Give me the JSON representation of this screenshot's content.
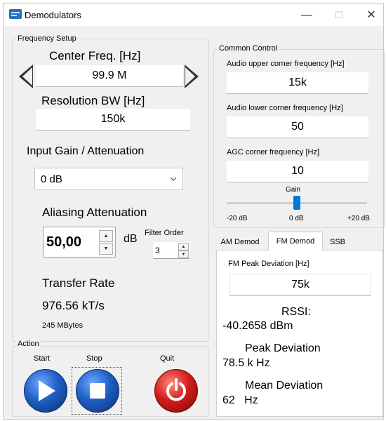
{
  "window": {
    "title": "Demodulators",
    "minimize_glyph": "—",
    "maximize_glyph": "☐",
    "close_glyph": "✕"
  },
  "frequency_setup": {
    "group_label": "Frequency Setup",
    "center_freq_label": "Center Freq. [Hz]",
    "center_freq_value": "99.9 M",
    "resolution_bw_label": "Resolution BW [Hz]",
    "resolution_bw_value": "150k",
    "input_gain_label": "Input Gain / Attenuation",
    "input_gain_value": "0 dB",
    "aliasing_label": "Aliasing Attenuation",
    "aliasing_value": "50,00",
    "aliasing_unit": "dB",
    "filter_order_label": "Filter Order",
    "filter_order_value": "3",
    "transfer_rate_label": "Transfer Rate",
    "transfer_rate_value": "976.56 kT/s",
    "bytes_value": "245 MBytes"
  },
  "action": {
    "group_label": "Action",
    "start_label": "Start",
    "stop_label": "Stop",
    "quit_label": "Quit"
  },
  "common_control": {
    "group_label": "Common Control",
    "audio_upper_label": "Audio upper corner frequency [Hz]",
    "audio_upper_value": "15k",
    "audio_lower_label": "Audio lower corner frequency [Hz]",
    "audio_lower_value": "50",
    "agc_label": "AGC corner frequency [Hz]",
    "agc_value": "10",
    "gain_label": "Gain",
    "gain_min": "-20 dB",
    "gain_mid": "0 dB",
    "gain_max": "+20 dB",
    "gain_level_db": 0
  },
  "tabs": {
    "am": "AM Demod",
    "fm": "FM Demod",
    "ssb": "SSB",
    "active": "FM Demod"
  },
  "fm_demod": {
    "peak_dev_field_label": "FM Peak Deviation [Hz]",
    "peak_dev_field_value": "75k",
    "rssi_label": "RSSI:",
    "rssi_value": "-40.2658 dBm",
    "peak_dev_label": "Peak Deviation",
    "peak_dev_value": "78.5 k Hz",
    "mean_dev_label": "Mean Deviation",
    "mean_dev_value": "62   Hz"
  },
  "colors": {
    "accent": "#0078d7",
    "play_blue": "#1f5fc4",
    "quit_red": "#d41d1d"
  }
}
